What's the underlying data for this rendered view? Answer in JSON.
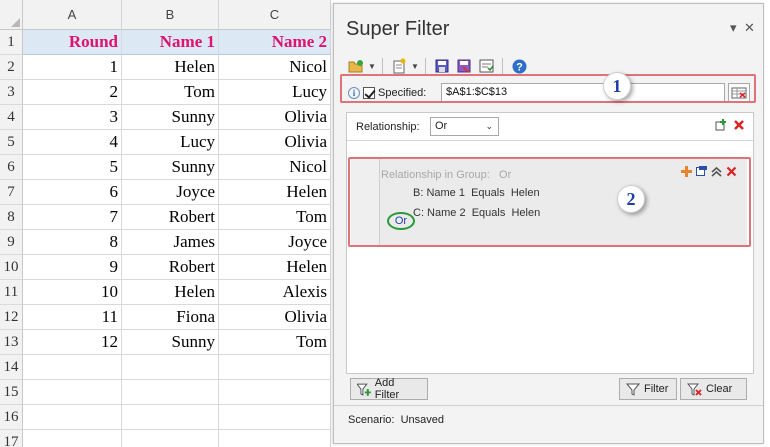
{
  "sheet": {
    "columns": [
      "A",
      "B",
      "C"
    ],
    "headers": [
      "Round",
      "Name 1",
      "Name 2"
    ],
    "rows": [
      {
        "n": "1",
        "a": "",
        "b": "",
        "c": ""
      },
      {
        "n": "2",
        "a": "1",
        "b": "Helen",
        "c": "Nicol"
      },
      {
        "n": "3",
        "a": "2",
        "b": "Tom",
        "c": "Lucy"
      },
      {
        "n": "4",
        "a": "3",
        "b": "Sunny",
        "c": "Olivia"
      },
      {
        "n": "5",
        "a": "4",
        "b": "Lucy",
        "c": "Olivia"
      },
      {
        "n": "6",
        "a": "5",
        "b": "Sunny",
        "c": "Nicol"
      },
      {
        "n": "7",
        "a": "6",
        "b": "Joyce",
        "c": "Helen"
      },
      {
        "n": "8",
        "a": "7",
        "b": "Robert",
        "c": "Tom"
      },
      {
        "n": "9",
        "a": "8",
        "b": "James",
        "c": "Joyce"
      },
      {
        "n": "10",
        "a": "9",
        "b": "Robert",
        "c": "Helen"
      },
      {
        "n": "11",
        "a": "10",
        "b": "Helen",
        "c": "Alexis"
      },
      {
        "n": "12",
        "a": "11",
        "b": "Fiona",
        "c": "Olivia"
      },
      {
        "n": "13",
        "a": "12",
        "b": "Sunny",
        "c": "Tom"
      },
      {
        "n": "14",
        "a": "",
        "b": "",
        "c": ""
      },
      {
        "n": "15",
        "a": "",
        "b": "",
        "c": ""
      },
      {
        "n": "16",
        "a": "",
        "b": "",
        "c": ""
      },
      {
        "n": "17",
        "a": "",
        "b": "",
        "c": ""
      }
    ]
  },
  "pane": {
    "title": "Super Filter",
    "dropdown_glyph": "▾",
    "close_glyph": "✕",
    "specified_label": "Specified:",
    "specified_checked": true,
    "range": "$A$1:$C$13",
    "relationship_label": "Relationship:",
    "relationship_value": "Or",
    "group": {
      "title": "Relationship in Group:",
      "title_value": "Or",
      "or_label": "Or",
      "conditions": [
        {
          "field": "B: Name 1",
          "op": "Equals",
          "value": "Helen"
        },
        {
          "field": "C: Name 2",
          "op": "Equals",
          "value": "Helen"
        }
      ]
    },
    "add_filter_label": "Add Filter",
    "filter_label": "Filter",
    "clear_label": "Clear",
    "scenario_label": "Scenario:",
    "scenario_value": "Unsaved"
  },
  "callouts": {
    "one": "1",
    "two": "2"
  },
  "colors": {
    "header_bg": "#dce9f5",
    "header_text": "#e0116f",
    "highlight": "#e0737a",
    "badge_text": "#1f3fa8",
    "or_ring": "#2a9a3a"
  }
}
